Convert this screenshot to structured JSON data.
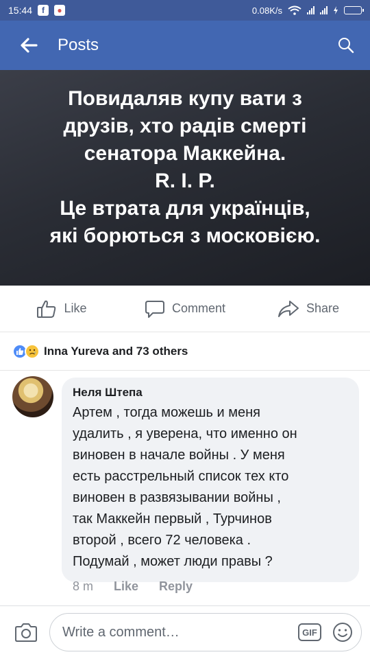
{
  "status_bar": {
    "time": "15:44",
    "app_icons": [
      "f",
      "●"
    ],
    "network_speed": "0.08K/s"
  },
  "app_bar": {
    "title": "Posts"
  },
  "post": {
    "text": "Повидаляв купу вати з\nдрузів, хто радів смерті\nсенатора Маккейна.\nR. I. P.\nЦе втрата для українців,\nякі борються з московією."
  },
  "actions": {
    "like": "Like",
    "comment": "Comment",
    "share": "Share"
  },
  "reactions": {
    "summary": "Inna  Yureva and 73 others"
  },
  "comment": {
    "author": "Неля Штепа",
    "text": "Артем , тогда можешь и меня\nудалить , я уверена, что именно он\nвиновен в начале войны .  У меня\nесть расстрельный список тех кто\nвиновен в развязывании войны ,\nтак Маккейн первый , Турчинов\nвторой , всего 72 человека .\nПодумай , может люди правы ?",
    "time": "8 m",
    "like_label": "Like",
    "reply_label": "Reply"
  },
  "composer": {
    "placeholder": "Write a comment…",
    "gif_label": "GIF"
  },
  "colors": {
    "status_bar": "#3f5a99",
    "app_bar": "#4267b2",
    "like_blue": "#4f8cf7"
  }
}
